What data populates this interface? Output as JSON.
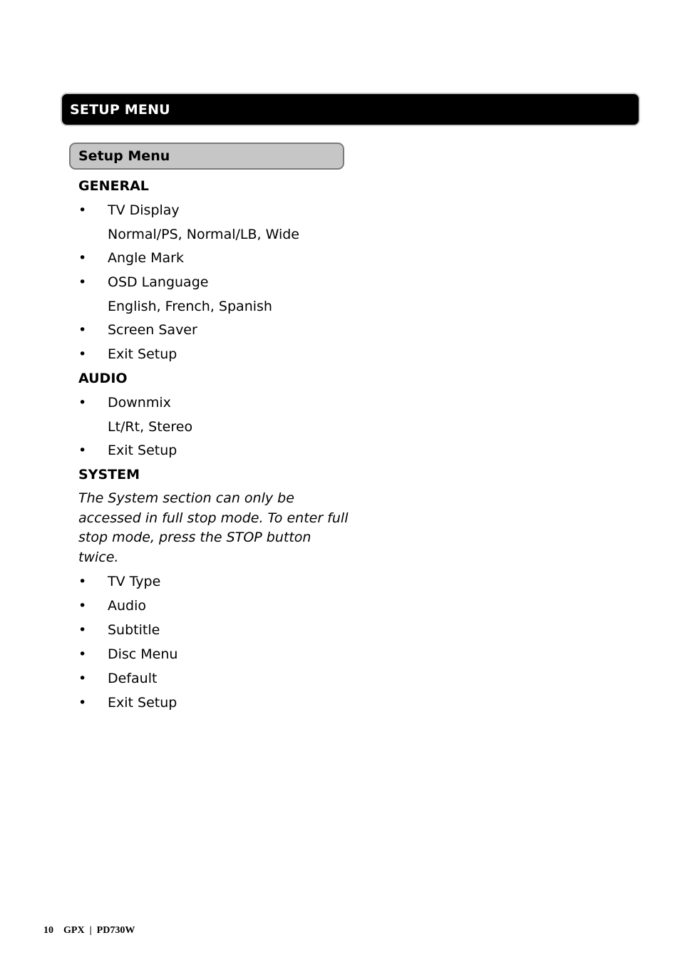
{
  "banner": {
    "title": "SETUP MENU"
  },
  "subheader": {
    "title": "Setup Menu"
  },
  "general": {
    "heading": "GENERAL",
    "items": [
      {
        "bullet": "•",
        "label": "TV Display",
        "options": "Normal/PS, Normal/LB, Wide"
      },
      {
        "bullet": "•",
        "label": "Angle Mark"
      },
      {
        "bullet": "•",
        "label": "OSD Language",
        "options": "English, French, Spanish"
      },
      {
        "bullet": "•",
        "label": "Screen Saver"
      },
      {
        "bullet": "•",
        "label": "Exit Setup"
      }
    ]
  },
  "audio": {
    "heading": "AUDIO",
    "items": [
      {
        "bullet": "•",
        "label": "Downmix",
        "options": "Lt/Rt, Stereo"
      },
      {
        "bullet": "•",
        "label": "Exit Setup"
      }
    ]
  },
  "system": {
    "heading": "SYSTEM",
    "note": "The System section can only be accessed in full stop mode. To enter full stop mode, press the STOP button twice.",
    "items": [
      {
        "bullet": "•",
        "label": "TV Type"
      },
      {
        "bullet": "•",
        "label": "Audio"
      },
      {
        "bullet": "•",
        "label": "Subtitle"
      },
      {
        "bullet": "•",
        "label": "Disc Menu"
      },
      {
        "bullet": "•",
        "label": "Default"
      },
      {
        "bullet": "•",
        "label": "Exit Setup"
      }
    ]
  },
  "footer": {
    "page_number": "10",
    "brand": "GPX",
    "separator": "|",
    "model": "PD730W"
  }
}
